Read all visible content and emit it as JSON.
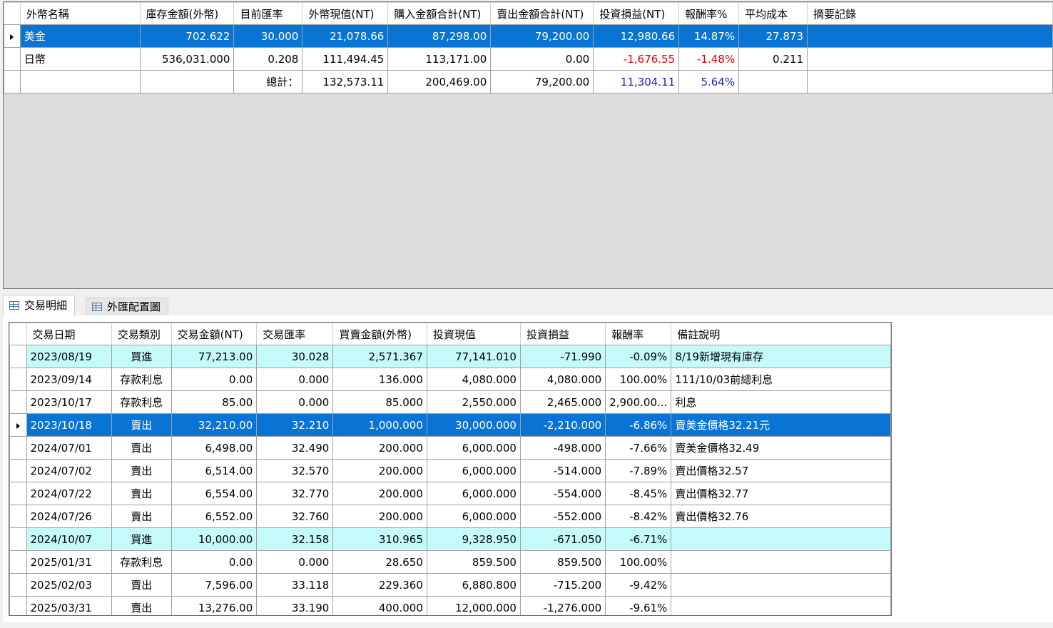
{
  "summary": {
    "columns": [
      "外幣名稱",
      "庫存金額(外幣)",
      "目前匯率",
      "外幣現值(NT)",
      "購入金額合計(NT)",
      "賣出金額合計(NT)",
      "投資損益(NT)",
      "報酬率%",
      "平均成本",
      "摘要記錄"
    ],
    "rows": [
      {
        "name": "美金",
        "holding": "702.622",
        "rate": "30.000",
        "value": "21,078.66",
        "buy_total": "87,298.00",
        "sell_total": "79,200.00",
        "pl": "12,980.66",
        "roi": "14.87%",
        "avg_cost": "27.873",
        "memo": ""
      },
      {
        "name": "日幣",
        "holding": "536,031.000",
        "rate": "0.208",
        "value": "111,494.45",
        "buy_total": "113,171.00",
        "sell_total": "0.00",
        "pl": "-1,676.55",
        "roi": "-1.48%",
        "avg_cost": "0.211",
        "memo": ""
      }
    ],
    "total": {
      "label": "總計：",
      "value": "132,573.11",
      "buy_total": "200,469.00",
      "sell_total": "79,200.00",
      "pl": "11,304.11",
      "roi": "5.64%"
    }
  },
  "tabs": [
    {
      "label": "交易明細",
      "icon": "grid-icon",
      "active": true
    },
    {
      "label": "外匯配置圖",
      "icon": "grid-icon",
      "active": false
    }
  ],
  "transactions": {
    "columns": [
      "交易日期",
      "交易類別",
      "交易金額(NT)",
      "交易匯率",
      "買賣金額(外幣)",
      "投資現值",
      "投資損益",
      "報酬率",
      "備註說明"
    ],
    "rows": [
      {
        "date": "2023/08/19",
        "type": "買進",
        "amount": "77,213.00",
        "rate": "30.028",
        "fx_amount": "2,571.367",
        "value": "77,141.010",
        "pl": "-71.990",
        "roi": "-0.09%",
        "note": "8/19新增現有庫存"
      },
      {
        "date": "2023/09/14",
        "type": "存款利息",
        "amount": "0.00",
        "rate": "0.000",
        "fx_amount": "136.000",
        "value": "4,080.000",
        "pl": "4,080.000",
        "roi": "100.00%",
        "note": "111/10/03前總利息"
      },
      {
        "date": "2023/10/17",
        "type": "存款利息",
        "amount": "85.00",
        "rate": "0.000",
        "fx_amount": "85.000",
        "value": "2,550.000",
        "pl": "2,465.000",
        "roi": "2,900.00...",
        "note": "利息"
      },
      {
        "date": "2023/10/18",
        "type": "賣出",
        "amount": "32,210.00",
        "rate": "32.210",
        "fx_amount": "1,000.000",
        "value": "30,000.000",
        "pl": "-2,210.000",
        "roi": "-6.86%",
        "note": "賣美金價格32.21元"
      },
      {
        "date": "2024/07/01",
        "type": "賣出",
        "amount": "6,498.00",
        "rate": "32.490",
        "fx_amount": "200.000",
        "value": "6,000.000",
        "pl": "-498.000",
        "roi": "-7.66%",
        "note": "賣美金價格32.49"
      },
      {
        "date": "2024/07/02",
        "type": "賣出",
        "amount": "6,514.00",
        "rate": "32.570",
        "fx_amount": "200.000",
        "value": "6,000.000",
        "pl": "-514.000",
        "roi": "-7.89%",
        "note": "賣出價格32.57"
      },
      {
        "date": "2024/07/22",
        "type": "賣出",
        "amount": "6,554.00",
        "rate": "32.770",
        "fx_amount": "200.000",
        "value": "6,000.000",
        "pl": "-554.000",
        "roi": "-8.45%",
        "note": "賣出價格32.77"
      },
      {
        "date": "2024/07/26",
        "type": "賣出",
        "amount": "6,552.00",
        "rate": "32.760",
        "fx_amount": "200.000",
        "value": "6,000.000",
        "pl": "-552.000",
        "roi": "-8.42%",
        "note": "賣出價格32.76"
      },
      {
        "date": "2024/10/07",
        "type": "買進",
        "amount": "10,000.00",
        "rate": "32.158",
        "fx_amount": "310.965",
        "value": "9,328.950",
        "pl": "-671.050",
        "roi": "-6.71%",
        "note": ""
      },
      {
        "date": "2025/01/31",
        "type": "存款利息",
        "amount": "0.00",
        "rate": "0.000",
        "fx_amount": "28.650",
        "value": "859.500",
        "pl": "859.500",
        "roi": "100.00%",
        "note": ""
      },
      {
        "date": "2025/02/03",
        "type": "賣出",
        "amount": "7,596.00",
        "rate": "33.118",
        "fx_amount": "229.360",
        "value": "6,880.800",
        "pl": "-715.200",
        "roi": "-9.42%",
        "note": ""
      },
      {
        "date": "2025/03/31",
        "type": "賣出",
        "amount": "13,276.00",
        "rate": "33.190",
        "fx_amount": "400.000",
        "value": "12,000.000",
        "pl": "-1,276.000",
        "roi": "-9.61%",
        "note": ""
      }
    ]
  },
  "colors": {
    "selection": "#0a74d4",
    "buy_row": "#c4fafa",
    "negative": "#e00000",
    "positive_total": "#1a1acd"
  }
}
